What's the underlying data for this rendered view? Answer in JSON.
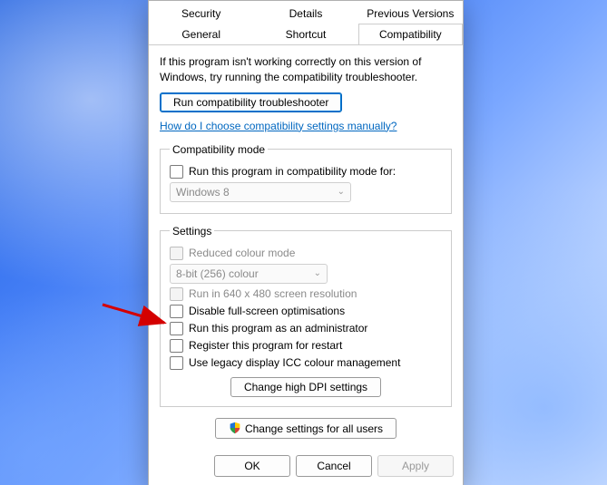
{
  "tabs": {
    "row1": [
      "Security",
      "Details",
      "Previous Versions"
    ],
    "row2": [
      "General",
      "Shortcut",
      "Compatibility"
    ],
    "active": "Compatibility"
  },
  "intro": "If this program isn't working correctly on this version of Windows, try running the compatibility troubleshooter.",
  "run_troubleshooter": "Run compatibility troubleshooter",
  "help_link": "How do I choose compatibility settings manually?",
  "compat_mode": {
    "legend": "Compatibility mode",
    "checkbox_label": "Run this program in compatibility mode for:",
    "selected": "Windows 8"
  },
  "settings": {
    "legend": "Settings",
    "reduced_colour": "Reduced colour mode",
    "reduced_colour_value": "8-bit (256) colour",
    "run_640": "Run in 640 x 480 screen resolution",
    "disable_fullscreen": "Disable full-screen optimisations",
    "run_admin": "Run this program as an administrator",
    "register_restart": "Register this program for restart",
    "legacy_icc": "Use legacy display ICC colour management",
    "high_dpi": "Change high DPI settings"
  },
  "change_all_users": "Change settings for all users",
  "buttons": {
    "ok": "OK",
    "cancel": "Cancel",
    "apply": "Apply"
  }
}
